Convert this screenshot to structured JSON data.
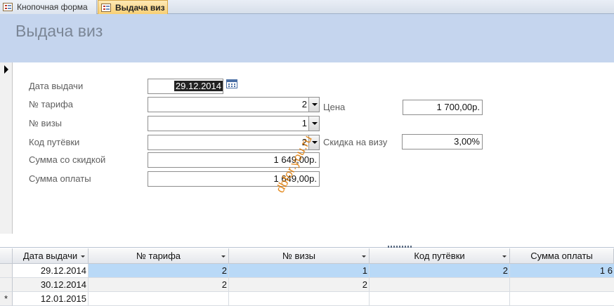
{
  "tabs": [
    {
      "label": "Кнопочная форма"
    },
    {
      "label": "Выдача виз"
    }
  ],
  "header": {
    "title": "Выдача виз"
  },
  "form": {
    "date_label": "Дата выдачи",
    "date_value": "29.12.2014",
    "tariff_label": "№ тарифа",
    "tariff_value": "2",
    "visa_label": "№ визы",
    "visa_value": "1",
    "voucher_label": "Код путёвки",
    "voucher_value": "2",
    "discounted_label": "Сумма со скидкой",
    "discounted_value": "1 649,00р.",
    "payment_label": "Сумма оплаты",
    "payment_value": "1 649,00р.",
    "price_label": "Цена",
    "price_value": "1 700,00р.",
    "discount_label": "Скидка на визу",
    "discount_value": "3,00%"
  },
  "watermark": "dbfor.you.ru",
  "grid": {
    "columns": [
      "Дата выдачи",
      "№ тарифа",
      "№ визы",
      "Код путёвки",
      "Сумма оплаты"
    ],
    "rows": [
      {
        "selector": "",
        "cells": [
          "29.12.2014",
          "2",
          "1",
          "2",
          "1 6"
        ]
      },
      {
        "selector": "",
        "cells": [
          "30.12.2014",
          "2",
          "2",
          "",
          ""
        ]
      },
      {
        "selector": "*",
        "cells": [
          "12.01.2015",
          "",
          "",
          "",
          ""
        ]
      }
    ]
  },
  "icons": {
    "tab_form_icon": "form-icon",
    "calendar": "calendar-icon",
    "dropdown": "chevron-down-icon",
    "record_pointer": "record-pointer-icon"
  }
}
